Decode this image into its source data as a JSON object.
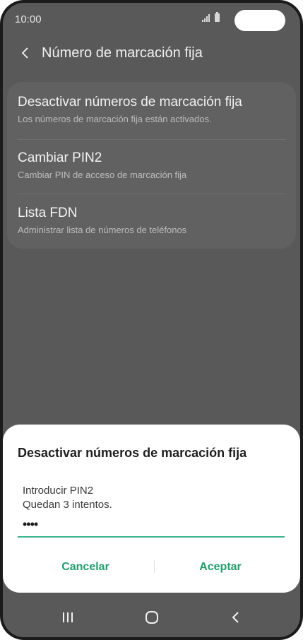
{
  "status_bar": {
    "time": "10:00",
    "signal_icon": "signal-icon",
    "battery_icon": "battery-icon"
  },
  "app_bar": {
    "back_icon": "chevron-left-icon",
    "title": "Número de marcación fija"
  },
  "settings": {
    "items": [
      {
        "title": "Desactivar números de marcación fija",
        "subtitle": "Los números de marcación fija están activados."
      },
      {
        "title": "Cambiar PIN2",
        "subtitle": "Cambiar PIN de acceso de marcación fija"
      },
      {
        "title": "Lista FDN",
        "subtitle": "Administrar lista de números de teléfonos"
      }
    ]
  },
  "dialog": {
    "title": "Desactivar números de marcación fija",
    "message_line1": "Introducir PIN2",
    "message_line2": "Quedan 3 intentos.",
    "pin_value": "••••",
    "cancel_label": "Cancelar",
    "accept_label": "Aceptar"
  },
  "colors": {
    "accent": "#1f9e6b",
    "input_underline": "#3db48d",
    "dim_background": "#595959"
  },
  "nav_bar": {
    "recents_icon": "recents-icon",
    "home_icon": "home-icon",
    "back_icon": "back-nav-icon"
  }
}
